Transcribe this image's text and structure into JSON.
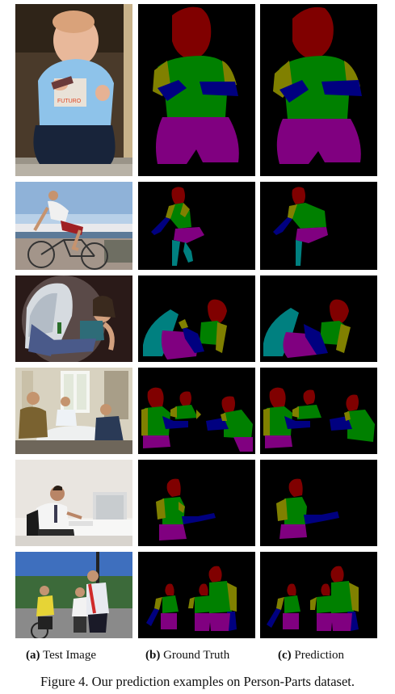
{
  "figure": {
    "column_labels": [
      {
        "tag": "(a)",
        "text": "Test Image"
      },
      {
        "tag": "(b)",
        "text": "Ground Truth"
      },
      {
        "tag": "(c)",
        "text": "Prediction"
      }
    ],
    "caption": "Figure 4. Our prediction examples on Person-Parts dataset."
  },
  "part_colors": {
    "head": "#800000",
    "torso": "#008000",
    "upper_arm": "#808000",
    "lower_arm": "#000080",
    "upper_leg": "#800080",
    "lower_leg": "#008080",
    "background": "#000000"
  },
  "image_text": {
    "shirt_print": "FUTURO"
  }
}
